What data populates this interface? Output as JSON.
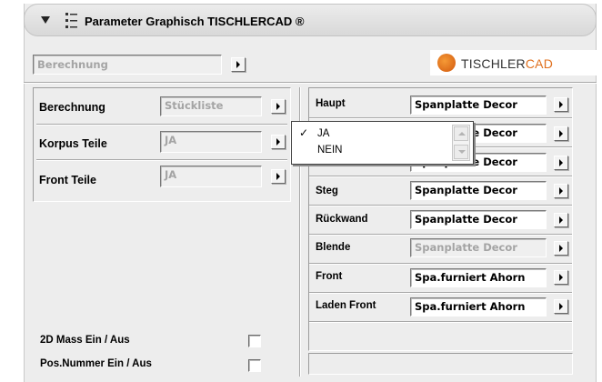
{
  "header": {
    "title": "Parameter Graphisch TISCHLERCAD ®",
    "collapse_icon": "disclosure-triangle-icon",
    "app_icon": "settings-list-icon"
  },
  "top_select": {
    "value": "Berechnung"
  },
  "logo": {
    "brand": "TISCHLER",
    "suffix": "CAD"
  },
  "left": {
    "rows": [
      {
        "label": "Berechnung",
        "value": "Stückliste"
      },
      {
        "label": "Korpus Teile",
        "value": "JA"
      },
      {
        "label": "Front Teile",
        "value": "JA"
      }
    ],
    "toggles": [
      {
        "label": "2D Mass Ein / Aus",
        "checked": false
      },
      {
        "label": "Pos.Nummer Ein / Aus",
        "checked": false
      }
    ]
  },
  "right": {
    "rows": [
      {
        "label": "Haupt",
        "value": "Spanplatte Decor",
        "disabled": false
      },
      {
        "label": "",
        "value": "Spanplatte Decor",
        "disabled": false
      },
      {
        "label": "",
        "value": "Spanplatte Decor",
        "disabled": false
      },
      {
        "label": "Steg",
        "value": "Spanplatte Decor",
        "disabled": false
      },
      {
        "label": "Rückwand",
        "value": "Spanplatte Decor",
        "disabled": false
      },
      {
        "label": "Blende",
        "value": "Spanplatte Decor",
        "disabled": true
      },
      {
        "label": "Front",
        "value": "Spa.furniert Ahorn",
        "disabled": false
      },
      {
        "label": "Laden Front",
        "value": "Spa.furniert Ahorn",
        "disabled": false
      }
    ]
  },
  "popup": {
    "options": [
      "JA",
      "NEIN"
    ],
    "selected": "JA",
    "check_mark": "✓"
  },
  "colors": {
    "panel": "#ededed",
    "disabled_text": "#a4a4a4",
    "logo_accent": "#e0701e"
  }
}
